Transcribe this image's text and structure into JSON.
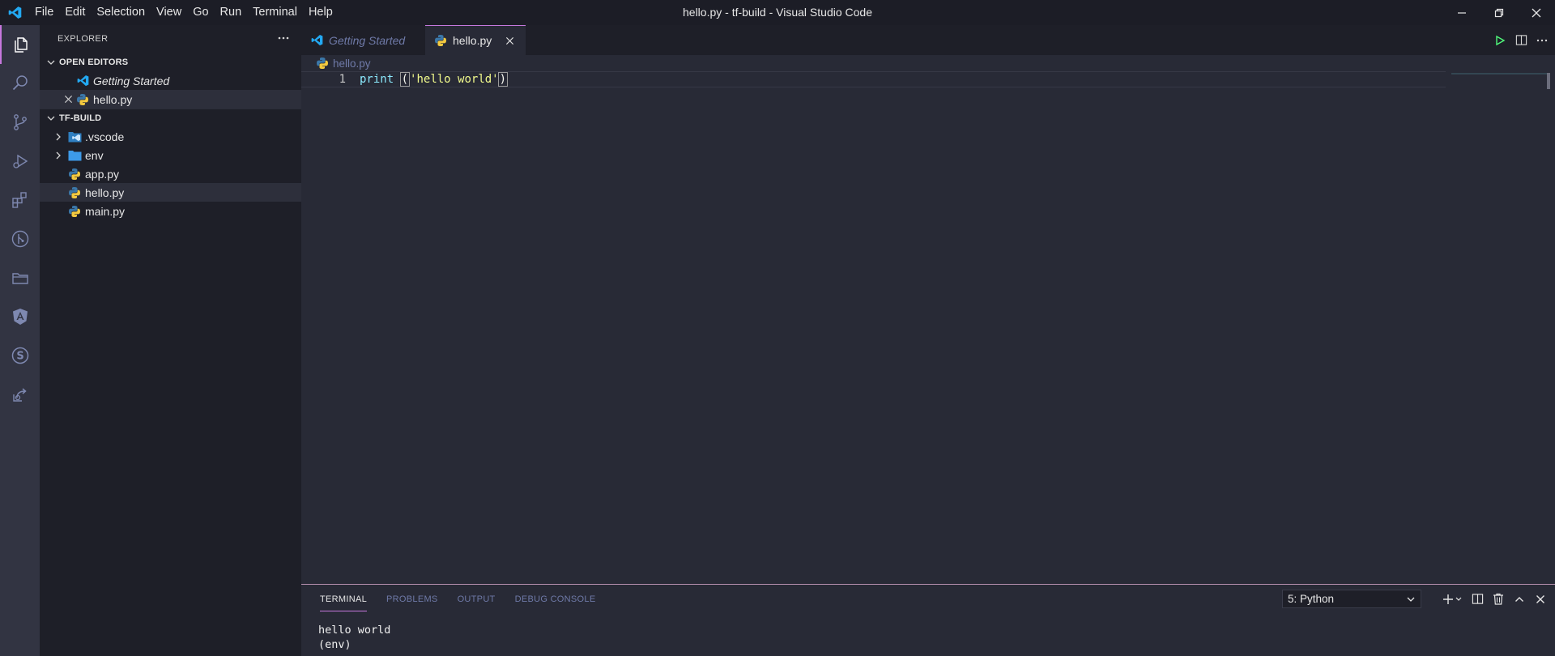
{
  "window": {
    "title": "hello.py - tf-build - Visual Studio Code"
  },
  "menu": [
    "File",
    "Edit",
    "Selection",
    "View",
    "Go",
    "Run",
    "Terminal",
    "Help"
  ],
  "sidebar": {
    "header": "EXPLORER",
    "open_editors": {
      "title": "OPEN EDITORS",
      "items": [
        {
          "label": "Getting Started",
          "icon": "vscode-icon"
        },
        {
          "label": "hello.py",
          "icon": "python-icon"
        }
      ]
    },
    "workspace": {
      "title": "TF-BUILD",
      "items": [
        {
          "label": ".vscode",
          "icon": "vscode-folder-icon",
          "type": "folder"
        },
        {
          "label": "env",
          "icon": "folder-icon",
          "type": "folder"
        },
        {
          "label": "app.py",
          "icon": "python-icon",
          "type": "file"
        },
        {
          "label": "hello.py",
          "icon": "python-icon",
          "type": "file",
          "selected": true
        },
        {
          "label": "main.py",
          "icon": "python-icon",
          "type": "file"
        }
      ]
    }
  },
  "tabs": [
    {
      "label": "Getting Started",
      "active": false
    },
    {
      "label": "hello.py",
      "active": true
    }
  ],
  "breadcrumb": "hello.py",
  "editor": {
    "line_number": "1",
    "code": {
      "keyword": "print",
      "space": " ",
      "open": "(",
      "string": "'hello world'",
      "close": ")"
    }
  },
  "panel": {
    "tabs": [
      "TERMINAL",
      "PROBLEMS",
      "OUTPUT",
      "DEBUG CONSOLE"
    ],
    "active_tab": "TERMINAL",
    "terminal_select": "5: Python",
    "terminal_lines": [
      "hello world",
      "(env)"
    ]
  },
  "colors": {
    "accent": "#c678dd",
    "background": "#282a36",
    "sidebar": "#1e1f28",
    "activitybar": "#323442"
  }
}
